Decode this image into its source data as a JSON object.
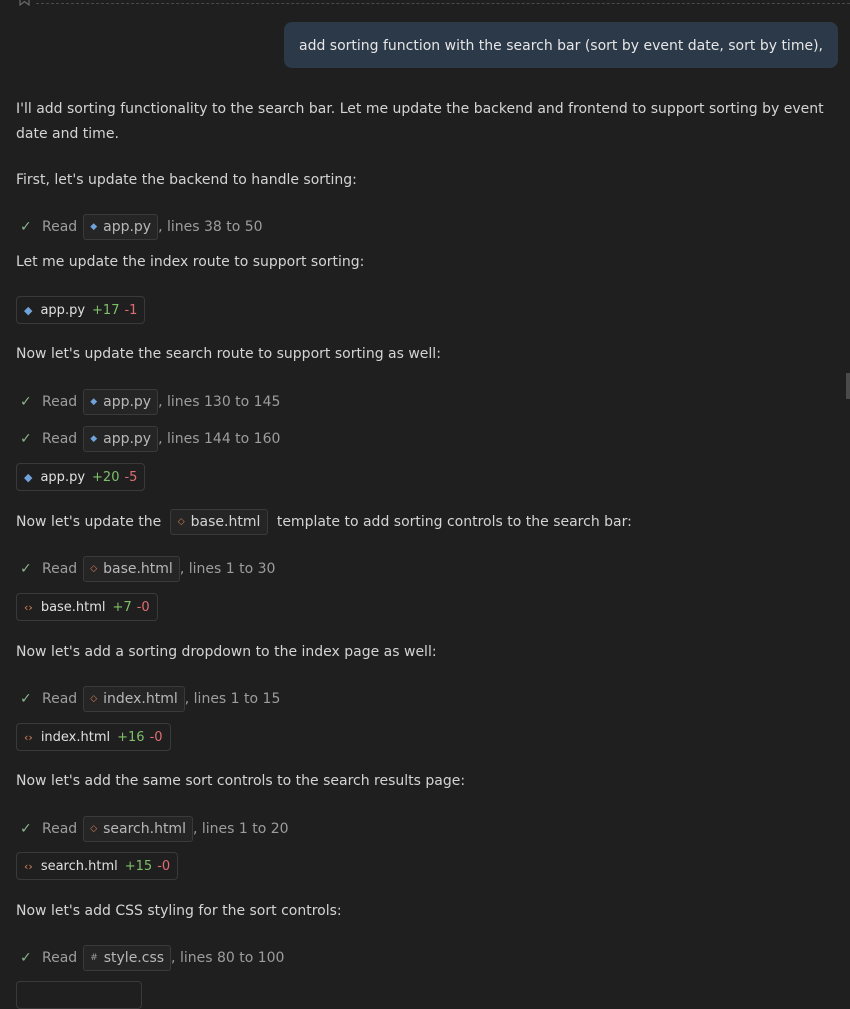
{
  "user_message": "add sorting function with the search bar (sort by event date, sort by time),",
  "intro": "I'll add sorting functionality to the search bar. Let me update the backend and frontend to support sorting by event date and time.",
  "step1": "First, let's update the backend to handle sorting:",
  "read_label": "Read",
  "read1": {
    "file": "app.py",
    "lines": ", lines 38 to 50"
  },
  "step2": "Let me update the index route to support sorting:",
  "edit1": {
    "file": "app.py",
    "add": "+17",
    "del": "-1"
  },
  "step3": "Now let's update the search route to support sorting as well:",
  "read2": {
    "file": "app.py",
    "lines": ", lines 130 to 145"
  },
  "read3": {
    "file": "app.py",
    "lines": ", lines 144 to 160"
  },
  "edit2": {
    "file": "app.py",
    "add": "+20",
    "del": "-5"
  },
  "step4": {
    "pre": "Now let's update the",
    "file": "base.html",
    "post": "template to add sorting controls to the search bar:"
  },
  "read4": {
    "file": "base.html",
    "lines": ", lines 1 to 30"
  },
  "edit3": {
    "file": "base.html",
    "add": "+7",
    "del": "-0"
  },
  "step5": "Now let's add a sorting dropdown to the index page as well:",
  "read5": {
    "file": "index.html",
    "lines": ", lines 1 to 15"
  },
  "edit4": {
    "file": "index.html",
    "add": "+16",
    "del": "-0"
  },
  "step6": "Now let's add the same sort controls to the search results page:",
  "read6": {
    "file": "search.html",
    "lines": ", lines 1 to 20"
  },
  "edit5": {
    "file": "search.html",
    "add": "+15",
    "del": "-0"
  },
  "step7": "Now let's add CSS styling for the sort controls:",
  "read7": {
    "file": "style.css",
    "lines": ", lines 80 to 100"
  },
  "icons": {
    "python": "python-file-icon",
    "html": "html-file-icon",
    "css": "css-file-icon",
    "check": "check-icon",
    "bookmark": "bookmark-icon"
  },
  "colors": {
    "add": "#7fbf6a",
    "del": "#e06c75",
    "bubble": "#2b3948"
  }
}
